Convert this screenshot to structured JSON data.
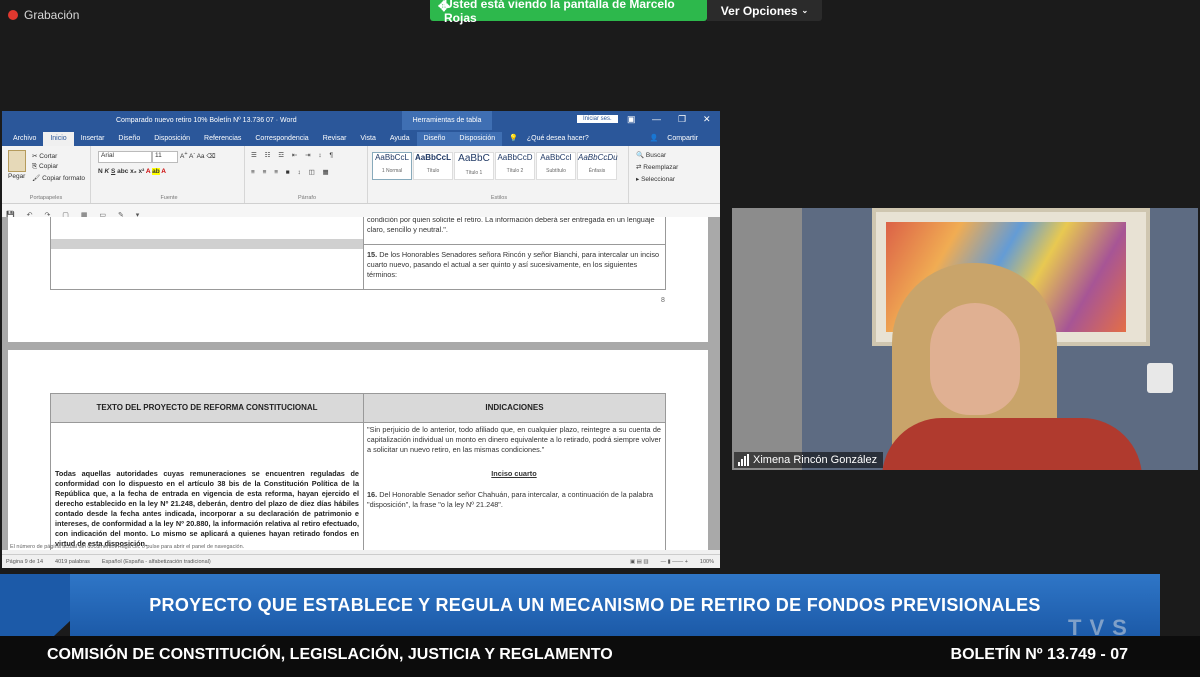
{
  "zoom": {
    "recording_label": "Grabación",
    "share_banner": "Usted está viendo la pantalla de Marcelo Rojas",
    "view_options": "Ver Opciones"
  },
  "word": {
    "title": "Comparado nuevo retiro 10% Boletín Nº 13.736 07   ·   Word",
    "context_tab": "Herramientas de tabla",
    "signin": "Iniciar ses.",
    "tabs": [
      "Archivo",
      "Inicio",
      "Insertar",
      "Diseño",
      "Disposición",
      "Referencias",
      "Correspondencia",
      "Revisar",
      "Vista",
      "Ayuda",
      "Diseño",
      "Disposición"
    ],
    "tell_me": "¿Qué desea hacer?",
    "share": "Compartir",
    "clipboard": {
      "paste": "Pegar",
      "cut": "Cortar",
      "copy": "Copiar",
      "format_painter": "Copiar formato",
      "label": "Portapapeles"
    },
    "font": {
      "name": "Arial",
      "size": "11",
      "label": "Fuente"
    },
    "paragraph_label": "Párrafo",
    "styles": [
      "1 Normal",
      "Título",
      "Título 1",
      "Título 2",
      "Subtítulo",
      "Énfasis"
    ],
    "styles_label": "Estilos",
    "editing": {
      "find": "Buscar",
      "replace": "Reemplazar",
      "select": "Seleccionar"
    },
    "page1": {
      "top_text": "condición por quien solicite el retiro. La información deberá ser entregada en un lenguaje claro, sencillo y neutral.\".",
      "para15_num": "15.",
      "para15": "De los Honorables Senadores señora Rincón y señor Bianchi, para intercalar un inciso cuarto nuevo, pasando el actual a ser quinto y así sucesivamente, en los siguientes términos:",
      "page_num": "8"
    },
    "page2": {
      "header_left": "TEXTO DEL PROYECTO DE REFORMA CONSTITUCIONAL",
      "header_right": "INDICACIONES",
      "right_quote": "\"Sin perjuicio de lo anterior, todo afiliado que, en cualquier plazo, reintegre a su cuenta de capitalización individual un monto en dinero equivalente a lo retirado, podrá siempre volver a solicitar un nuevo retiro, en las mismas condiciones.\"",
      "inciso": "Inciso cuarto",
      "para16_num": "16.",
      "para16": "Del Honorable Senador señor Chahuán, para intercalar, a continuación de la palabra \"disposición\", la frase \"o la ley Nº 21.248\".",
      "left_text": "Todas aquellas autoridades cuyas remuneraciones se encuentren reguladas de conformidad con lo dispuesto en el artículo 38 bis de la Constitución Política de la República que, a la fecha de entrada en vigencia de esta reforma, hayan ejercido el derecho establecido en la ley Nº 21.248, deberán, dentro del plazo de diez días hábiles contado desde la fecha antes indicada, incorporar a su declaración de patrimonio e intereses, de conformidad a la ley Nº 20.880, la información relativa al retiro efectuado, con indicación del monto. Lo mismo se aplicará a quienes hayan retirado fondos en virtud de esta disposición."
    },
    "hint": "El número de página actual del documento. Haga clic o pulse para abrir el panel de navegación.",
    "status": {
      "page": "Página 9 de 14",
      "words": "4019 palabras",
      "lang": "Español (España - alfabetización tradicional)",
      "zoom": "100%"
    }
  },
  "participant": {
    "name": "Ximena Rincón González"
  },
  "broadcast": {
    "headline": "PROYECTO QUE ESTABLECE Y REGULA UN MECANISMO DE RETIRO DE FONDOS PREVISIONALES",
    "committee": "COMISIÓN DE CONSTITUCIÓN, LEGISLACIÓN, JUSTICIA Y REGLAMENTO",
    "bulletin": "BOLETÍN Nº 13.749 - 07",
    "logo": "TVS"
  },
  "colors": {
    "word_blue": "#2b579a",
    "zoom_green": "#2db84c",
    "banner_blue": "#1c5aa8"
  }
}
